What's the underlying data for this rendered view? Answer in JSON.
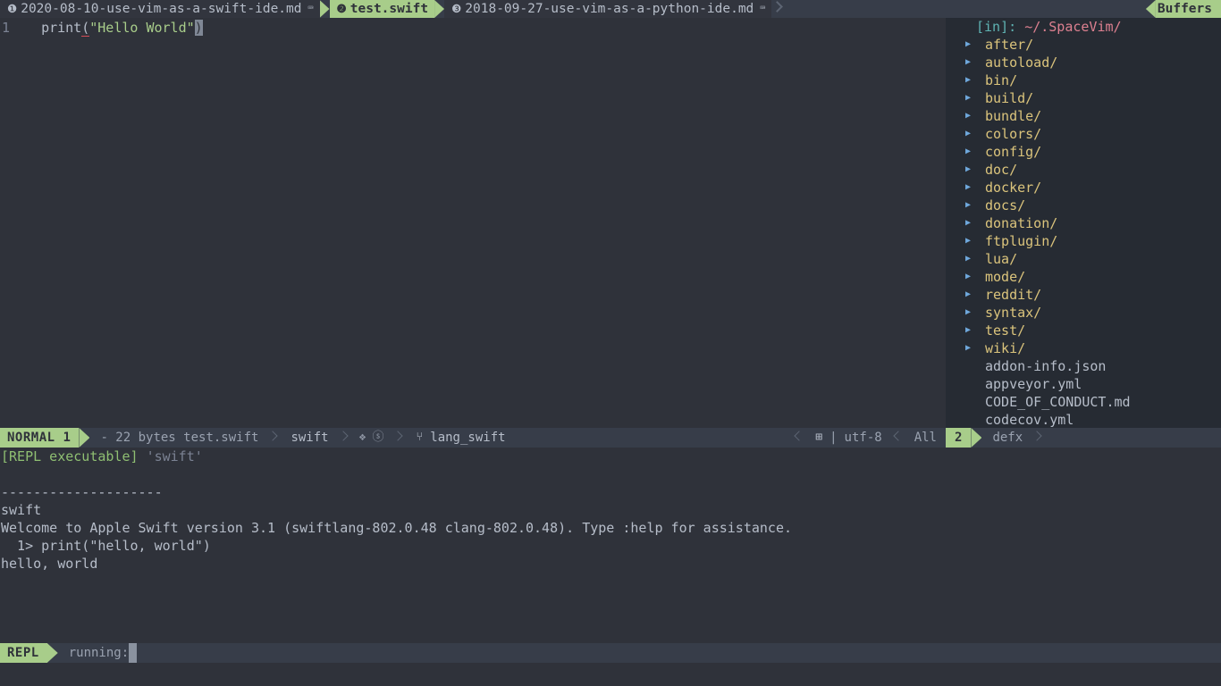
{
  "theme": {
    "bg": "#2f323a",
    "panel_bg": "#262b33",
    "statusline_bg": "#373d49",
    "accent_green": "#a8cd8a",
    "fg": "#b6bdc9",
    "dir_yellow": "#dbc47c",
    "string_green": "#a8cd8a",
    "path_pink": "#dd8090",
    "teal": "#5fb3b3"
  },
  "tabline": {
    "tabs": [
      {
        "index": "❶",
        "label": "2020-08-10-use-vim-as-a-swift-ide.md",
        "glyph": "⌨",
        "active": false
      },
      {
        "index": "❷",
        "label": "test.swift",
        "glyph": "",
        "active": true
      },
      {
        "index": "❸",
        "label": "2018-09-27-use-vim-as-a-python-ide.md",
        "glyph": "⌨",
        "active": false
      }
    ],
    "buffers_label": "Buffers"
  },
  "editor": {
    "lines": [
      {
        "number": "1",
        "indent": "  ",
        "fn": "print",
        "open_paren": "(",
        "string": "\"Hello World\"",
        "close_paren": ")"
      }
    ]
  },
  "tree": {
    "header_prefix": "[in]:",
    "header_path": "~/.SpaceVim/",
    "arrow_glyph": "▶",
    "items": [
      {
        "name": "after/",
        "type": "dir"
      },
      {
        "name": "autoload/",
        "type": "dir"
      },
      {
        "name": "bin/",
        "type": "dir"
      },
      {
        "name": "build/",
        "type": "dir"
      },
      {
        "name": "bundle/",
        "type": "dir"
      },
      {
        "name": "colors/",
        "type": "dir"
      },
      {
        "name": "config/",
        "type": "dir"
      },
      {
        "name": "doc/",
        "type": "dir"
      },
      {
        "name": "docker/",
        "type": "dir"
      },
      {
        "name": "docs/",
        "type": "dir"
      },
      {
        "name": "donation/",
        "type": "dir"
      },
      {
        "name": "ftplugin/",
        "type": "dir"
      },
      {
        "name": "lua/",
        "type": "dir"
      },
      {
        "name": "mode/",
        "type": "dir"
      },
      {
        "name": "reddit/",
        "type": "dir"
      },
      {
        "name": "syntax/",
        "type": "dir"
      },
      {
        "name": "test/",
        "type": "dir"
      },
      {
        "name": "wiki/",
        "type": "dir"
      },
      {
        "name": "addon-info.json",
        "type": "file"
      },
      {
        "name": "appveyor.yml",
        "type": "file"
      },
      {
        "name": "CODE_OF_CONDUCT.md",
        "type": "file"
      },
      {
        "name": "codecov.yml",
        "type": "file"
      }
    ]
  },
  "statusline": {
    "mode": "NORMAL 1",
    "file_info": "- 22 bytes test.swift",
    "filetype": "swift",
    "icon_diamond": "❖",
    "icon_circle_s": "ⓢ",
    "icon_branch": "⑂",
    "branch": "lang_swift",
    "icon_os": "⊞",
    "separator": "|",
    "encoding": "utf-8",
    "scroll": "All"
  },
  "tree_statusline": {
    "window_number": "2",
    "name": "defx"
  },
  "terminal": {
    "lines": [
      {
        "type": "repl_exec",
        "label": "[REPL executable]",
        "value": "'swift'"
      },
      {
        "type": "blank",
        "text": ""
      },
      {
        "type": "plain",
        "text": "--------------------"
      },
      {
        "type": "plain",
        "text": "swift"
      },
      {
        "type": "plain",
        "text": "Welcome to Apple Swift version 3.1 (swiftlang-802.0.48 clang-802.0.48). Type :help for assistance."
      },
      {
        "type": "plain",
        "text": "  1> print(\"hello, world\")"
      },
      {
        "type": "plain",
        "text": "hello, world"
      }
    ]
  },
  "bottom_status": {
    "title": "REPL",
    "status": "running:"
  }
}
